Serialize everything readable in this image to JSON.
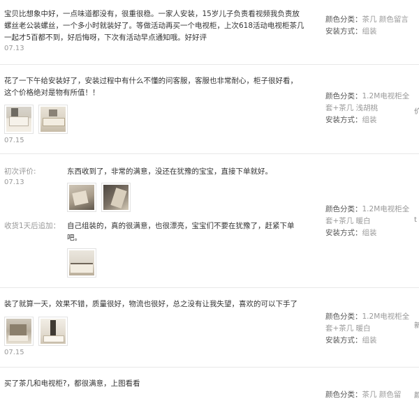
{
  "labels": {
    "color_key": "颜色分类：",
    "install_key": "安装方式：",
    "initial": "初次评价:",
    "followup": "收货1天后追加："
  },
  "reviews": [
    {
      "text": "宝贝比想象中好，一点味道都没有，很重很稳。一家人安装，15岁儿子负责看视频我负责放螺丝老公装螺丝，一个多小时就装好了。等做活动再买一个电视柜，上次618活动电视柜茶几一起才5百都不到，好后悔呀，下次有活动早点通知哦。好好评",
      "date": "07.13",
      "color": "茶几 颜色留言",
      "install": "组装"
    },
    {
      "text": "花了一下午给安装好了，安装过程中有什么不懂的问客服，客服也非常耐心，柜子很好看，这个价格绝对是物有所值！！",
      "date": "07.15",
      "color": "1.2M电视柜全套+茶几 浅胡桃",
      "install": "组装",
      "edge": "价"
    },
    {
      "initial_text": "东西收到了，非常的满意，没还在犹豫的宝宝，直接下单就好。",
      "date": "07.13",
      "followup_text": "自己组装的，真的很满意，也很漂亮，宝宝们不要在犹豫了，赶紧下单吧。",
      "color": "1.2M电视柜全套+茶几 暖白",
      "install": "组装",
      "edge": "t"
    },
    {
      "text": "装了就算一天，效果不错，质量很好，物流也很好，总之没有让我失望，喜欢的可以下手了",
      "date": "07.15",
      "color": "1.2M电视柜全套+茶几 暖白",
      "install": "组装",
      "edge": "新"
    },
    {
      "text": "买了茶几和电视柜?，都很满意，上图看看",
      "color": "茶几 颜色留",
      "edge": "颜"
    }
  ],
  "colors": {
    "muted": "#999999",
    "text": "#333333",
    "divider": "#e8e8e8"
  }
}
